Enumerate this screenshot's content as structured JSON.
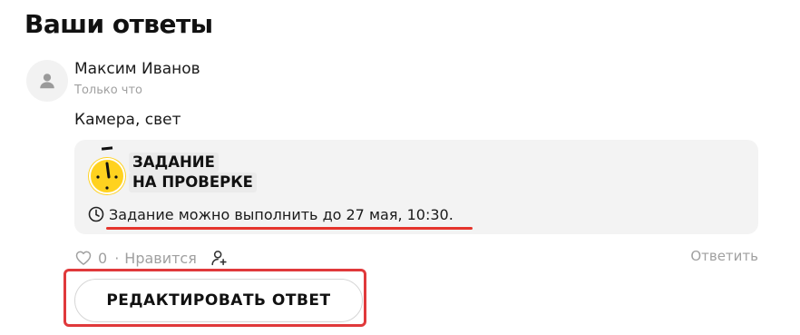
{
  "section": {
    "title": "Ваши ответы"
  },
  "answer": {
    "author": "Максим Иванов",
    "time": "Только что",
    "text": "Камера, свет"
  },
  "task": {
    "status_line1": "ЗАДАНИЕ",
    "status_line2": "НА ПРОВЕРКЕ",
    "deadline": "Задание можно выполнить до 27 мая, 10:30."
  },
  "actions": {
    "like_count": "0",
    "separator": "·",
    "like_label": "Нравится",
    "reply_label": "Ответить"
  },
  "edit_button": {
    "label": "РЕДАКТИРОВАТЬ ОТВЕТ"
  },
  "icons": {
    "avatar": "user-avatar-icon",
    "timer": "timer-icon",
    "clock": "clock-icon",
    "like": "heart-icon",
    "follow": "add-user-icon"
  },
  "colors": {
    "highlight": "#e0393b",
    "underline": "#e5342c",
    "timer_yellow": "#ffd21f",
    "muted": "#a0a0a0"
  }
}
